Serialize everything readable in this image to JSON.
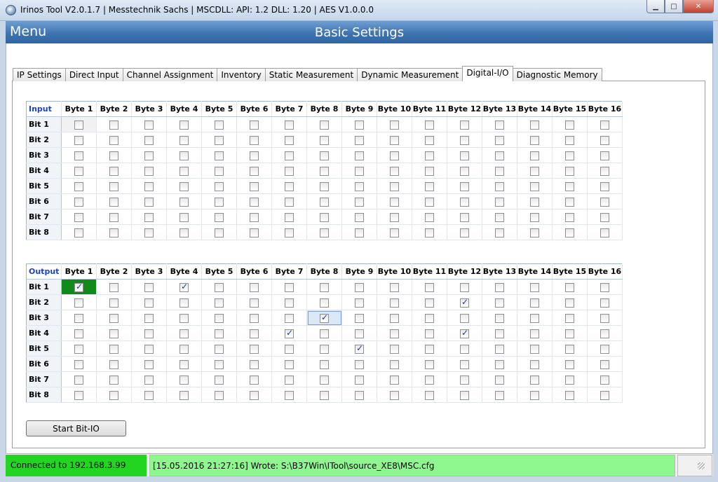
{
  "window": {
    "title": "Irinos Tool V2.0.1.7 | Messtechnik Sachs | MSCDLL: API: 1.2 DLL: 1.20 | AES V1.0.0.0"
  },
  "header": {
    "menu_label": "Menu",
    "title": "Basic Settings"
  },
  "tabs": [
    {
      "label": "IP Settings",
      "active": false
    },
    {
      "label": "Direct Input",
      "active": false
    },
    {
      "label": "Channel Assignment",
      "active": false
    },
    {
      "label": "Inventory",
      "active": false
    },
    {
      "label": "Static Measurement",
      "active": false
    },
    {
      "label": "Dynamic Measurement",
      "active": false
    },
    {
      "label": "Digital-I/O",
      "active": true
    },
    {
      "label": "Diagnostic Memory",
      "active": false
    }
  ],
  "columns": [
    "Byte 1",
    "Byte 2",
    "Byte 3",
    "Byte 4",
    "Byte 5",
    "Byte 6",
    "Byte 7",
    "Byte 8",
    "Byte 9",
    "Byte 10",
    "Byte 11",
    "Byte 12",
    "Byte 13",
    "Byte 14",
    "Byte 15",
    "Byte 16"
  ],
  "rows": [
    "Bit 1",
    "Bit 2",
    "Bit 3",
    "Bit 4",
    "Bit 5",
    "Bit 6",
    "Bit 7",
    "Bit 8"
  ],
  "input_grid": {
    "label": "Input",
    "checked": []
  },
  "output_grid": {
    "label": "Output",
    "checked": [
      [
        0,
        0
      ],
      [
        0,
        3
      ],
      [
        1,
        11
      ],
      [
        2,
        7
      ],
      [
        3,
        6
      ],
      [
        3,
        11
      ],
      [
        4,
        8
      ]
    ],
    "highlight_green": [
      0,
      0
    ],
    "focused": [
      2,
      7
    ]
  },
  "buttons": {
    "start_label": "Start Bit-IO"
  },
  "status": {
    "connection": "Connected to 192.168.3.99",
    "message": "[15.05.2016 21:27:16] Wrote: S:\\B37Win\\ITool\\source_XE8\\MSC.cfg"
  },
  "colors": {
    "header_blue": "#3f74b2",
    "connected_green": "#21d521",
    "message_green": "#8ef78e",
    "active_cell_green": "#0f8a1b",
    "grid_label_blue": "#1a44c4"
  }
}
